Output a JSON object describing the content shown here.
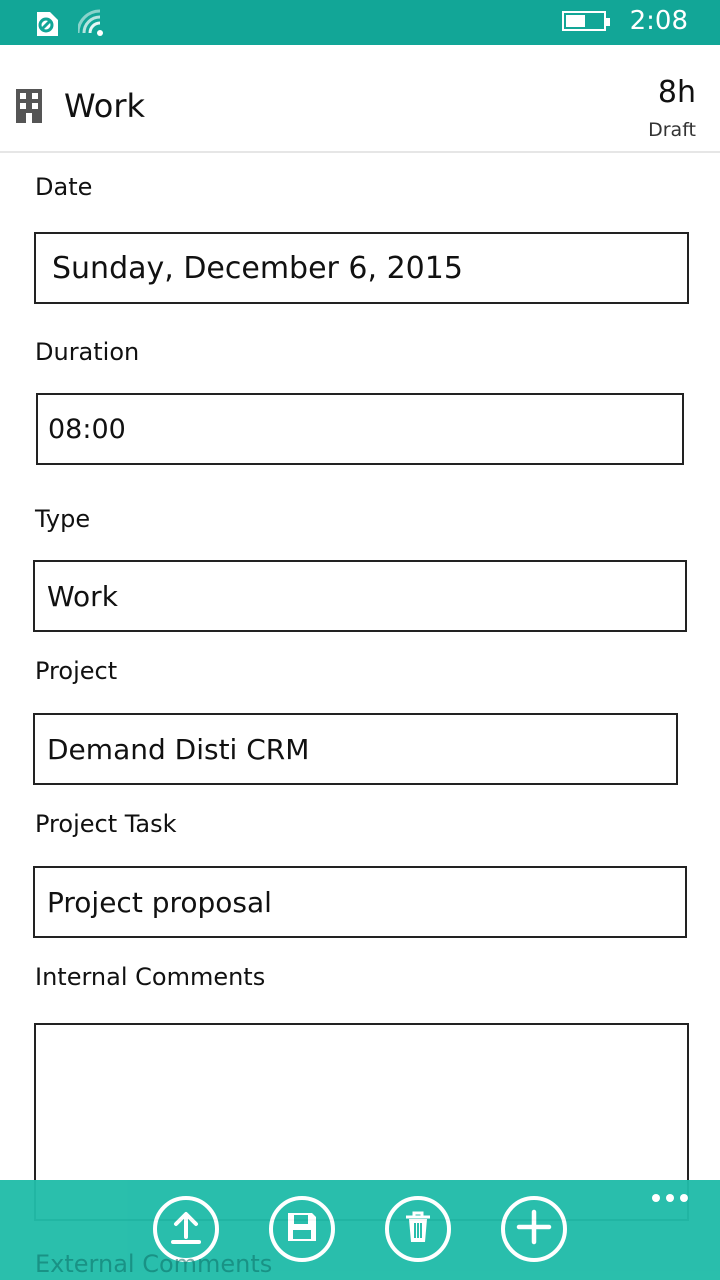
{
  "status_bar": {
    "time": "2:08",
    "battery_level": 0.55,
    "icons": [
      "sync-icon",
      "wifi-icon",
      "battery-icon"
    ]
  },
  "header": {
    "title": "Work",
    "hours": "8h",
    "state": "Draft",
    "icon": "building-icon"
  },
  "form": {
    "date_label": "Date",
    "date_value": "Sunday, December 6, 2015",
    "duration_label": "Duration",
    "duration_value": "08:00",
    "type_label": "Type",
    "type_value": "Work",
    "project_label": "Project",
    "project_value": "Demand Disti CRM",
    "project_task_label": "Project Task",
    "project_task_value": "Project proposal",
    "internal_comments_label": "Internal Comments",
    "internal_comments_value": "",
    "external_comments_label": "External Comments"
  },
  "app_bar": {
    "buttons": [
      "upload-icon",
      "save-icon",
      "delete-icon",
      "add-icon"
    ],
    "more": "more-icon"
  },
  "colors": {
    "status_bar": "#12a697",
    "app_bar": "#21bca9"
  }
}
